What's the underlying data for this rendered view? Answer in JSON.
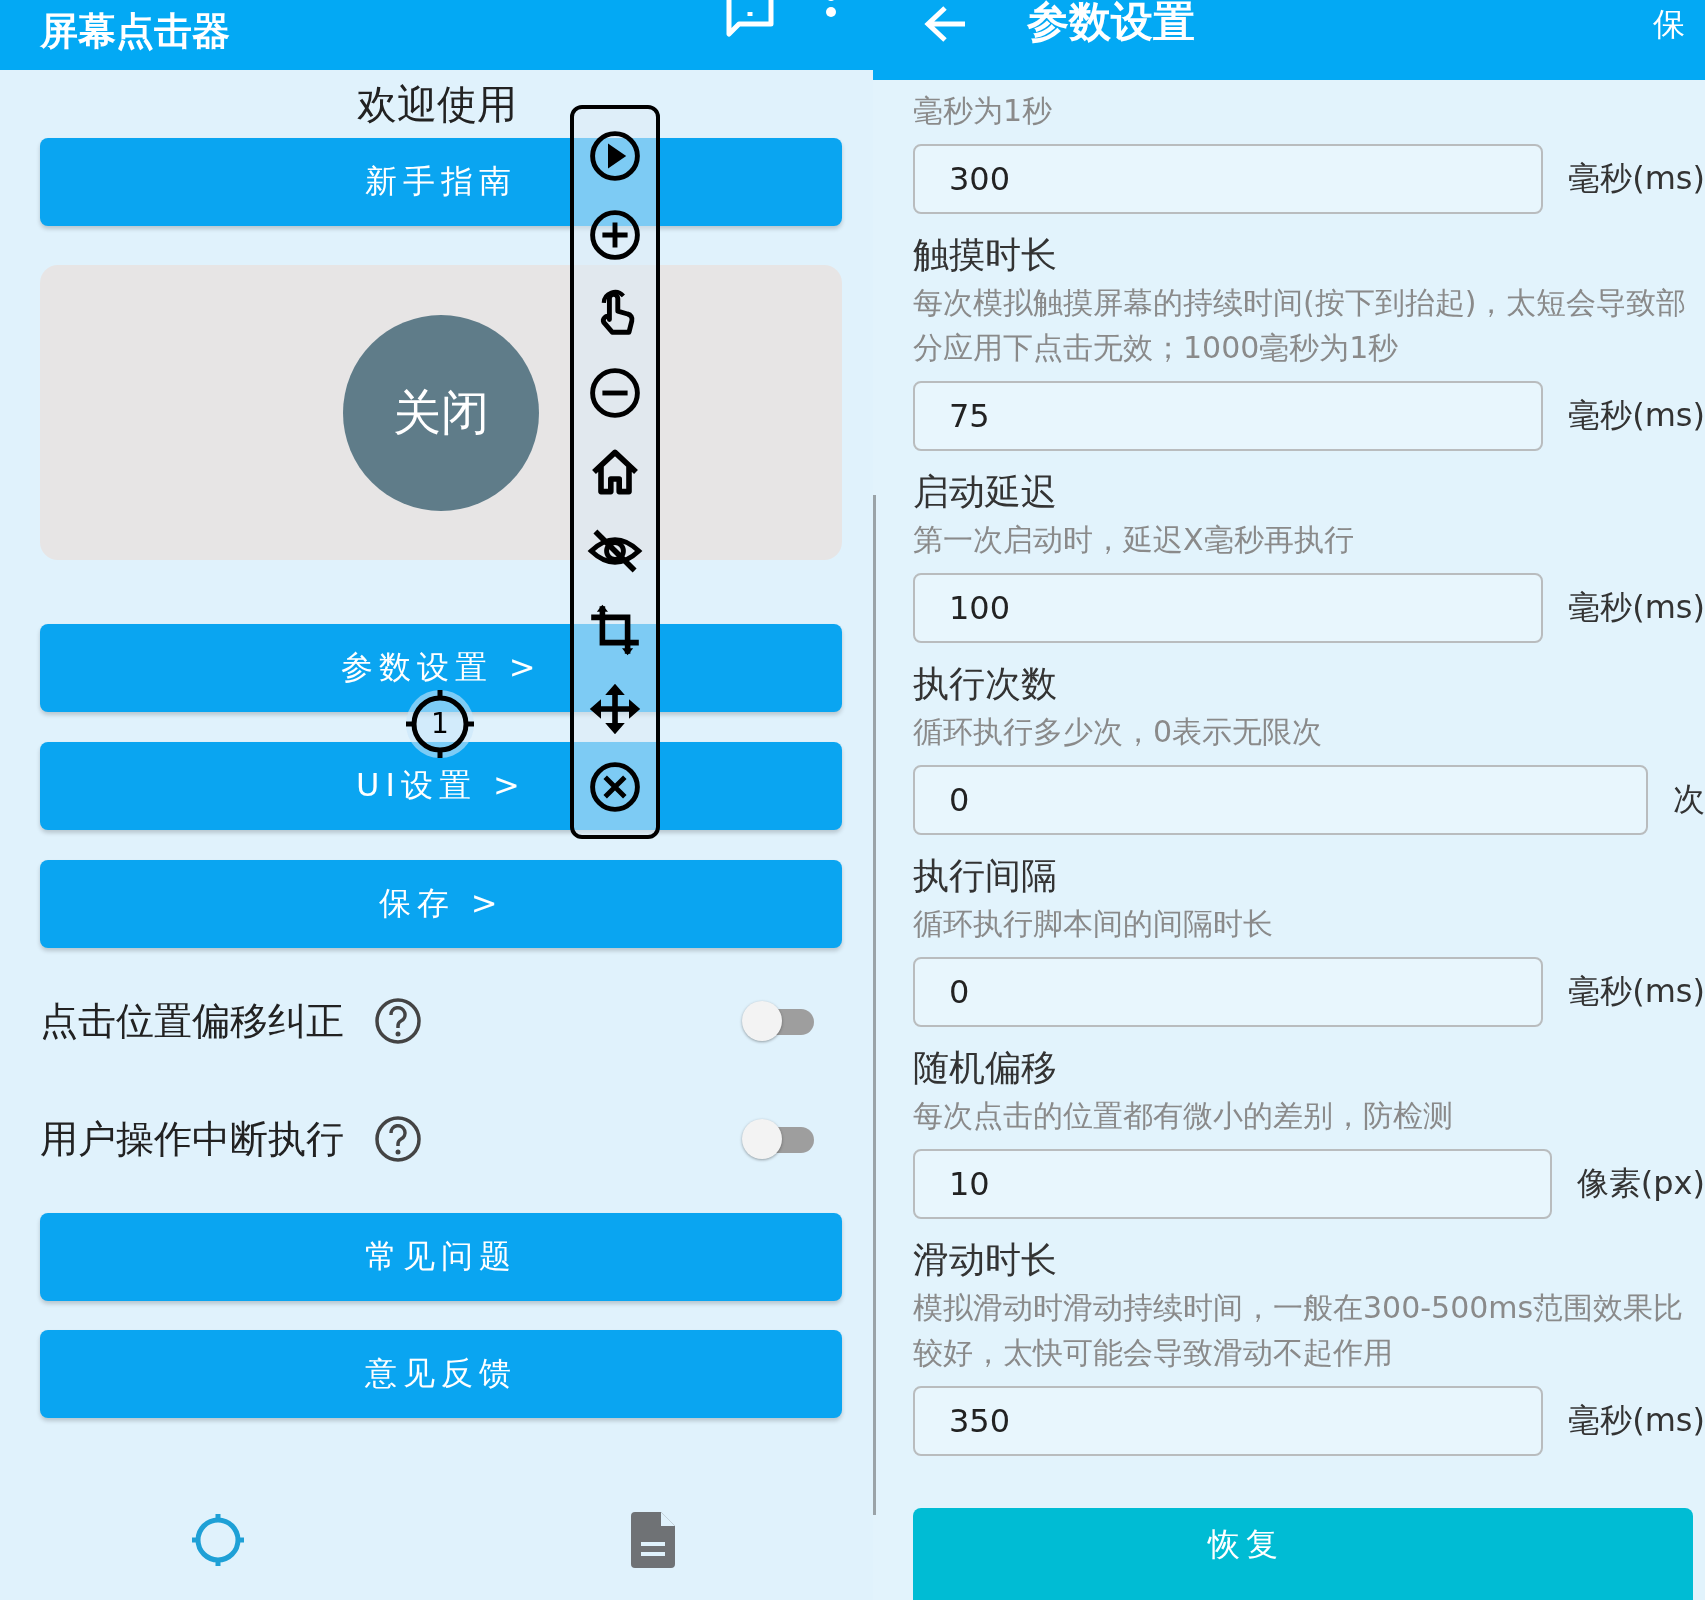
{
  "main_screen": {
    "title": "屏幕点击器",
    "welcome": "欢迎使用",
    "guide_button": "新手指南",
    "close_button": "关闭",
    "menu_buttons": [
      "参数设置 >",
      "UI设置 >",
      "保存 >"
    ],
    "marker": "1",
    "toggles": [
      {
        "label": "点击位置偏移纠正",
        "checked": false
      },
      {
        "label": "用户操作中断执行",
        "checked": false
      }
    ],
    "bottom_buttons": [
      "常见问题",
      "意见反馈"
    ],
    "bottom_nav": [
      {
        "kind": "target",
        "selected": true
      },
      {
        "kind": "document",
        "selected": false
      }
    ]
  },
  "settings_screen": {
    "title": "参数设置",
    "action": "保",
    "fields": [
      {
        "description": "毫秒为1秒",
        "value": "300",
        "unit": "毫秒(ms)"
      },
      {
        "title": "触摸时长",
        "description": "每次模拟触摸屏幕的持续时间(按下到抬起)，太短会导致部分应用下点击无效；1000毫秒为1秒",
        "value": "75",
        "unit": "毫秒(ms)"
      },
      {
        "title": "启动延迟",
        "description": "第一次启动时，延迟X毫秒再执行",
        "value": "100",
        "unit": "毫秒(ms)"
      },
      {
        "title": "执行次数",
        "description": "循环执行多少次，0表示无限次",
        "value": "0",
        "unit": "次"
      },
      {
        "title": "执行间隔",
        "description": "循环执行脚本间的间隔时长",
        "value": "0",
        "unit": "毫秒(ms)"
      },
      {
        "title": "随机偏移",
        "description": "每次点击的位置都有微小的差别，防检测",
        "value": "10",
        "unit": "像素(px)"
      },
      {
        "title": "滑动时长",
        "description": "模拟滑动时滑动持续时间，一般在300-500ms范围效果比较好，太快可能会导致滑动不起作用",
        "value": "350",
        "unit": "毫秒(ms)"
      }
    ],
    "restore_button": "恢复"
  }
}
